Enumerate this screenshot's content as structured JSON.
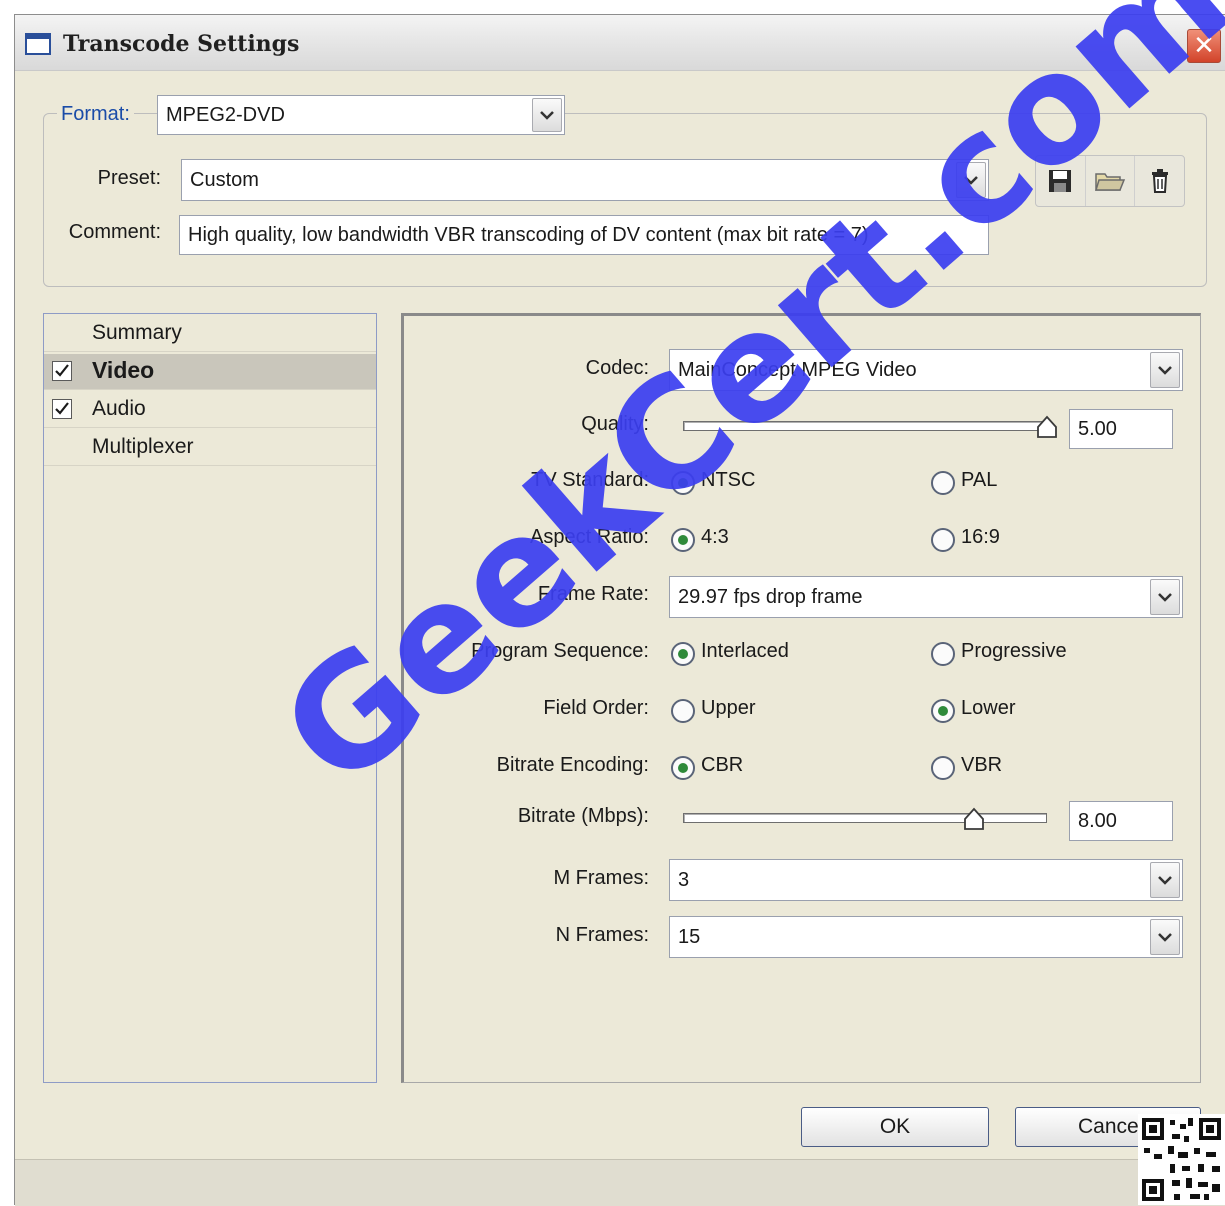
{
  "window": {
    "title": "Transcode Settings",
    "close_glyph": "✕"
  },
  "format": {
    "label": "Format:",
    "value": "MPEG2-DVD"
  },
  "preset": {
    "label": "Preset:",
    "value": "Custom"
  },
  "comment": {
    "label": "Comment:",
    "value": "High quality, low bandwidth VBR transcoding of DV content (max bit rate = 7)"
  },
  "toolbar": {
    "icons": [
      "save-icon",
      "open-folder-icon",
      "delete-icon"
    ]
  },
  "nav": {
    "items": [
      {
        "label": "Summary",
        "checked": false,
        "selected": false
      },
      {
        "label": "Video",
        "checked": true,
        "selected": true
      },
      {
        "label": "Audio",
        "checked": true,
        "selected": false
      },
      {
        "label": "Multiplexer",
        "checked": false,
        "selected": false
      }
    ]
  },
  "video": {
    "codec": {
      "label": "Codec:",
      "value": "MainConcept MPEG Video"
    },
    "quality": {
      "label": "Quality:",
      "value": "5.00",
      "level": 1.0
    },
    "tv_standard": {
      "label": "TV Standard:",
      "option1": "NTSC",
      "option2": "PAL",
      "selected": "NTSC"
    },
    "aspect_ratio": {
      "label": "Aspect Ratio:",
      "option1": "4:3",
      "option2": "16:9",
      "selected": "4:3"
    },
    "frame_rate": {
      "label": "Frame Rate:",
      "value": "29.97 fps drop frame"
    },
    "program_sequence": {
      "label": "Program Sequence:",
      "option1": "Interlaced",
      "option2": "Progressive",
      "selected": "Interlaced"
    },
    "field_order": {
      "label": "Field Order:",
      "option1": "Upper",
      "option2": "Lower",
      "selected": "Lower"
    },
    "bitrate_encoding": {
      "label": "Bitrate Encoding:",
      "option1": "CBR",
      "option2": "VBR",
      "selected": "CBR"
    },
    "bitrate": {
      "label": "Bitrate (Mbps):",
      "value": "8.00",
      "level": 0.8
    },
    "m_frames": {
      "label": "M Frames:",
      "value": "3"
    },
    "n_frames": {
      "label": "N Frames:",
      "value": "15"
    }
  },
  "buttons": {
    "ok": "OK",
    "cancel": "Cance"
  },
  "watermark": {
    "text": "GeekCert.com"
  },
  "colors": {
    "accent": "#1a4ca8",
    "watermark": "#3b3ef0",
    "radio_dot": "#2f8a3a",
    "close": "#d2432a"
  }
}
